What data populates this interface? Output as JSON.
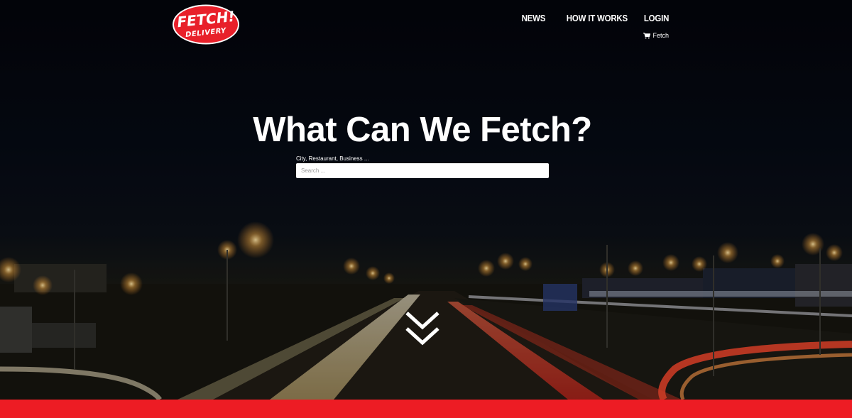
{
  "brand": {
    "logo_top": "FETCH!",
    "logo_bottom": "DELIVERY",
    "logo_color": "#e8202a"
  },
  "nav": {
    "items": [
      {
        "label": "NEWS"
      },
      {
        "label": "HOW IT WORKS"
      },
      {
        "label": "LOGIN"
      }
    ],
    "cart_label": "Fetch",
    "cart_icon": "shopping-cart-icon"
  },
  "hero": {
    "title": "What Can We Fetch?",
    "search_label": "City, Restaurant, Business ...",
    "search_placeholder": "Search ...",
    "search_value": "",
    "scroll_icon": "double-chevron-down-icon"
  },
  "colors": {
    "accent": "#ed1c24",
    "text": "#ffffff"
  }
}
